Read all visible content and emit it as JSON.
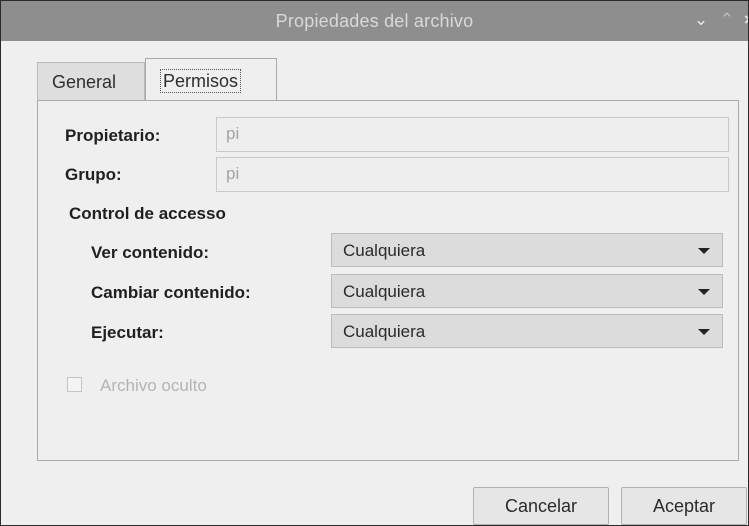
{
  "window": {
    "title": "Propiedades del archivo",
    "controls": {
      "minimize": "⌄",
      "maximize": "⌃",
      "close": "×"
    }
  },
  "tabs": [
    {
      "label": "General",
      "active": false
    },
    {
      "label": "Permisos",
      "active": true
    }
  ],
  "fields": {
    "owner": {
      "label": "Propietario:",
      "value": "pi"
    },
    "group": {
      "label": "Grupo:",
      "value": "pi"
    }
  },
  "access_control": {
    "title": "Control de accesso",
    "rows": [
      {
        "label": "Ver contenido:",
        "value": "Cualquiera"
      },
      {
        "label": "Cambiar contenido:",
        "value": "Cualquiera"
      },
      {
        "label": "Ejecutar:",
        "value": "Cualquiera"
      }
    ]
  },
  "hidden_file": {
    "label": "Archivo oculto",
    "checked": false,
    "enabled": false
  },
  "buttons": {
    "cancel": "Cancelar",
    "accept": "Aceptar"
  }
}
